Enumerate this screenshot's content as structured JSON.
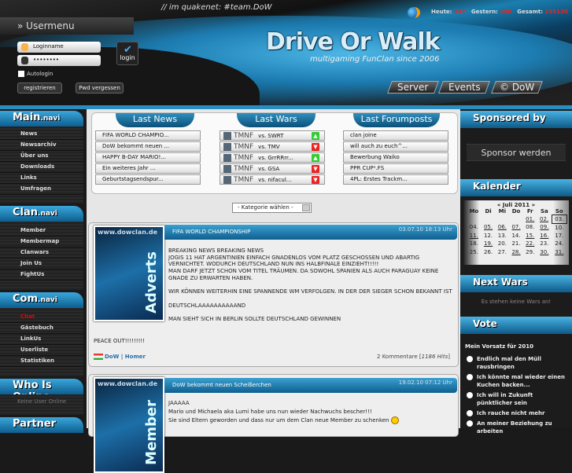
{
  "header": {
    "irc": "// im quakenet: #team.DoW",
    "stats": {
      "today_label": "Heute:",
      "today": "137",
      "yesterday_label": "Gestern:",
      "yesterday": "190",
      "total_label": "Gesamt:",
      "total": "235130"
    },
    "logo": "Drive Or Walk",
    "slogan": "multigaming FunClan since 2006",
    "nav": [
      "Server",
      "Events",
      "© DoW"
    ]
  },
  "usermenu": {
    "title": "» Usermenu",
    "login_placeholder": "Loginname",
    "password_value": "••••••••",
    "login_button": "login",
    "autologin": "Autologin",
    "register": "registrieren",
    "forgot": "Pwd vergessen"
  },
  "sidebar": {
    "main": {
      "title": "Main",
      "suffix": ".navi",
      "items": [
        "News",
        "Newsarchiv",
        "Über uns",
        "Downloads",
        "Links",
        "Umfragen"
      ]
    },
    "clan": {
      "title": "Clan",
      "suffix": ".navi",
      "items": [
        "Member",
        "Membermap",
        "Clanwars",
        "Join Us",
        "FightUs"
      ]
    },
    "com": {
      "title": "Com",
      "suffix": ".navi",
      "items": [
        "Chat",
        "Gästebuch",
        "LinkUs",
        "Userliste",
        "Statistiken"
      ],
      "active": "Chat"
    },
    "online": {
      "title": "Who Is Online",
      "text": "Keine User Online"
    },
    "partner": {
      "title": "Partner"
    }
  },
  "tabs": {
    "news": {
      "title": "Last News",
      "items": [
        "FIFA WORLD CHAMPIO...",
        "DoW bekommt neuen ...",
        "HAPPY B-DAY MARIO!...",
        "Ein weiteres Jahr ...",
        "Geburtstagsendspur..."
      ]
    },
    "wars": {
      "title": "Last Wars",
      "items": [
        {
          "game": "TMNF",
          "opponent": "vs. SWRT",
          "result": "win"
        },
        {
          "game": "TMNF",
          "opponent": "vs. TMV",
          "result": "loss"
        },
        {
          "game": "TMNF",
          "opponent": "vs. GrrRRrr...",
          "result": "win"
        },
        {
          "game": "TMNF",
          "opponent": "vs. GSA",
          "result": "loss"
        },
        {
          "game": "TMNF",
          "opponent": "vs. nifacul...",
          "result": "loss"
        }
      ]
    },
    "forum": {
      "title": "Last Forumposts",
      "items": [
        "clan joine",
        "will auch zu euch^...",
        "Bewerbung Waiko",
        "PPR CUP².FS",
        "4PL: Erstes Trackm..."
      ]
    }
  },
  "category_select": "- Kategorie wählen -",
  "news": [
    {
      "image_url_text": "www.dowclan.de",
      "image_label": "Adverts",
      "title": "FIFA WORLD CHAMPIONSHIP",
      "date": "03.07.10 18:13 Uhr",
      "body": "BREAKING NEWS BREAKING NEWS\nJOGIS 11 HAT ARGENTINIEN EINFACH GNADENLOS VOM PLATZ GESCHOSSEN UND ABARTIG VERNICHTET. WODURCH DEUTSCHLAND NUN INS HALBFINALE EINZIEHT!!!!!\nMAN DARF JETZT SCHON VOM TITEL TRÄUMEN. DA SOWOHL SPANIEN ALS AUCH PARAGUAY KEINE GNADE ZU ERWARTEN HABEN.\n\nWIR KÖNNEN WEITERHIN EINE SPANNENDE WM VERFOLGEN. IN DER DER SIEGER SCHON BEKANNT IST\n\nDEUTSCHLAAAAAAAAAAND\n\nMAN SIEHT SICH IN BERLIN SOLLTE DEUTSCHLAND GEWINNEN",
      "outro": "PEACE OUT!!!!!!!!!",
      "author": "DoW | Homer",
      "comments": "2 Kommentare [",
      "hits": "1186 Hits",
      "comments_end": "]"
    },
    {
      "image_url_text": "www.dowclan.de",
      "image_label": "Member",
      "title": "DoW bekommt neuen Scheißerchen",
      "date": "19.02.10 07:12 Uhr",
      "body": "JAAAAA\nMario und Michaela aka Lumi habe uns nun wieder Nachwuchs bescher!!!\nSie sind Eltern geworden und dass nur um dem Clan neue Member zu schenken"
    }
  ],
  "right": {
    "sponsor": {
      "title": "Sponsored by",
      "button": "Sponsor werden"
    },
    "calendar": {
      "title": "Kalender",
      "month": "« Juli 2011 »",
      "weekdays": [
        "Mo",
        "Di",
        "Mi",
        "Do",
        "Fr",
        "Sa",
        "So"
      ],
      "weeks": [
        [
          "",
          "",
          "",
          "",
          "01.",
          "02.",
          "03."
        ],
        [
          "04.",
          "05.",
          "06.",
          "07.",
          "08.",
          "09.",
          "10."
        ],
        [
          "11.",
          "12.",
          "13.",
          "14.",
          "15.",
          "16.",
          "17."
        ],
        [
          "18.",
          "19.",
          "20.",
          "21.",
          "22.",
          "23.",
          "24."
        ],
        [
          "25.",
          "26.",
          "27.",
          "28.",
          "29.",
          "30.",
          "31."
        ]
      ],
      "linked": [
        "01.",
        "02.",
        "05.",
        "06.",
        "07.",
        "09.",
        "11.",
        "15.",
        "16.",
        "19.",
        "22.",
        "28.",
        "30.",
        "31."
      ],
      "today": "03."
    },
    "nextwars": {
      "title": "Next Wars",
      "text": "Es stehen keine Wars an!"
    },
    "vote": {
      "title": "Vote",
      "question": "Mein Vorsatz für 2010",
      "options": [
        "Endlich mal den Müll rausbringen",
        "Ich könnte mal wieder einen Kuchen backen...",
        "Ich will in Zukunft pünktlicher sein",
        "Ich rauche nicht mehr",
        "An meiner Beziehung zu arbeiten"
      ]
    }
  },
  "colors": {
    "accent": "#1d7db2",
    "win": "#3c3",
    "loss": "#e22",
    "active_nav": "#e00"
  }
}
